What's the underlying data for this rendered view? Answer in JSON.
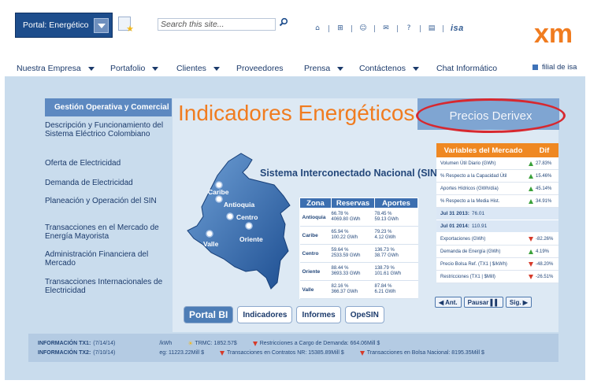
{
  "header": {
    "portal_label": "Portal: Energético",
    "search_placeholder": "Search this site...",
    "util_icons": [
      "home-icon",
      "sitemap-icon",
      "people-icon",
      "mail-icon",
      "help-icon",
      "document-icon"
    ],
    "isa_label": "isa",
    "logo_text": "xm",
    "logo_color": "#f07c20"
  },
  "nav": {
    "items": [
      {
        "label": "Nuestra Empresa",
        "has_menu": true
      },
      {
        "label": "Portafolio",
        "has_menu": true
      },
      {
        "label": "Clientes",
        "has_menu": true
      },
      {
        "label": "Proveedores",
        "has_menu": false
      },
      {
        "label": "Prensa",
        "has_menu": true
      },
      {
        "label": "Contáctenos",
        "has_menu": true
      },
      {
        "label": "Chat Informático",
        "has_menu": false
      }
    ],
    "filial_label": "filial de isa"
  },
  "sidebar": {
    "heading": "Gestión Operativa y Comercial",
    "items": [
      {
        "label": "Descripción y Funcionamiento del Sistema Eléctrico Colombiano"
      },
      {
        "label": "Oferta de Electricidad"
      },
      {
        "label": "Demanda de Electricidad"
      },
      {
        "label": "Planeación y Operación del SIN"
      },
      {
        "label": "Transacciones en el Mercado de Energía Mayorista"
      },
      {
        "label": "Administración Financiera del Mercado"
      },
      {
        "label": "Transacciones Internacionales de Electricidad"
      }
    ]
  },
  "main": {
    "title": "Indicadores Energéticos",
    "derivex_label": "Precios Derivex",
    "map_title": "Sistema Interconectado Nacional (SIN)",
    "regions": [
      "Caribe",
      "Antioquia",
      "Centro",
      "Oriente",
      "Valle"
    ]
  },
  "zone_table": {
    "headers": [
      "Zona",
      "Reservas",
      "Aportes"
    ],
    "rows": [
      {
        "zona": "Antioquia",
        "reservas": [
          "66.78 %",
          "4069.80 GWh"
        ],
        "aportes": [
          "78.45 %",
          "59.13 GWh"
        ]
      },
      {
        "zona": "Caribe",
        "reservas": [
          "65.94 %",
          "100.22 GWh"
        ],
        "aportes": [
          "79.23 %",
          "4.12 GWh"
        ]
      },
      {
        "zona": "Centro",
        "reservas": [
          "59.64 %",
          "2533.59 GWh"
        ],
        "aportes": [
          "136.73 %",
          "38.77 GWh"
        ]
      },
      {
        "zona": "Oriente",
        "reservas": [
          "88.44 %",
          "3693.33 GWh"
        ],
        "aportes": [
          "138.79 %",
          "101.61 GWh"
        ]
      },
      {
        "zona": "Valle",
        "reservas": [
          "82.16 %",
          "366.37 GWh"
        ],
        "aportes": [
          "87.84 %",
          "6.21 GWh"
        ]
      }
    ]
  },
  "variables": {
    "header_left": "Variables del Mercado",
    "header_right": "Dif",
    "rows_top": [
      {
        "name": "Volumen Útil Diario (GWh)",
        "dir": "up",
        "dif": "27.83%"
      },
      {
        "name": "% Respecto a la Capacidad Útil",
        "dir": "up",
        "dif": "15.46%"
      },
      {
        "name": "Aportes Hídricos (GWh/día)",
        "dir": "up",
        "dif": "45.14%"
      },
      {
        "name": "% Respecto a la Media Hist.",
        "dir": "up",
        "dif": "34.91%"
      }
    ],
    "highlights": [
      {
        "date": "Jul 31 2013:",
        "value": "76.01"
      },
      {
        "date": "Jul 01 2014:",
        "value": "110.91"
      }
    ],
    "rows_bottom": [
      {
        "name": "Exportaciones (GWh)",
        "dir": "down",
        "dif": "-82.26%"
      },
      {
        "name": "Demanda de Energía (GWh)",
        "dir": "up",
        "dif": "4.19%"
      },
      {
        "name": "Precio Bolsa Ref. (TX1 | $/kWh)",
        "dir": "down",
        "dif": "-48.20%"
      },
      {
        "name": "Restricciones (TX1 | $Mill)",
        "dir": "down",
        "dif": "-26.51%"
      }
    ],
    "controls": [
      "◀ Ant.",
      "Pausar ▌▌",
      "Sig. ▶"
    ]
  },
  "tabs": [
    "Portal BI",
    "Indicadores",
    "Informes",
    "OpeSIN"
  ],
  "ticker": {
    "row1": {
      "label": "INFORMACIÓN TX1:",
      "date": "(7/14/14)",
      "unit": "/kWh",
      "trmc": "TRMC: 1852.57$",
      "restr": "Restricciones a Cargo de Demanda: 664.06Mill $"
    },
    "row2": {
      "label": "INFORMACIÓN TX2:",
      "date": "(7/10/14)",
      "eg": "eg: 11223.22Mill $",
      "contratos": "Transacciones en Contratos NR: 15385.89Mill $",
      "bolsa": "Transacciones en Bolsa Nacional: 8195.35Mill $"
    }
  }
}
